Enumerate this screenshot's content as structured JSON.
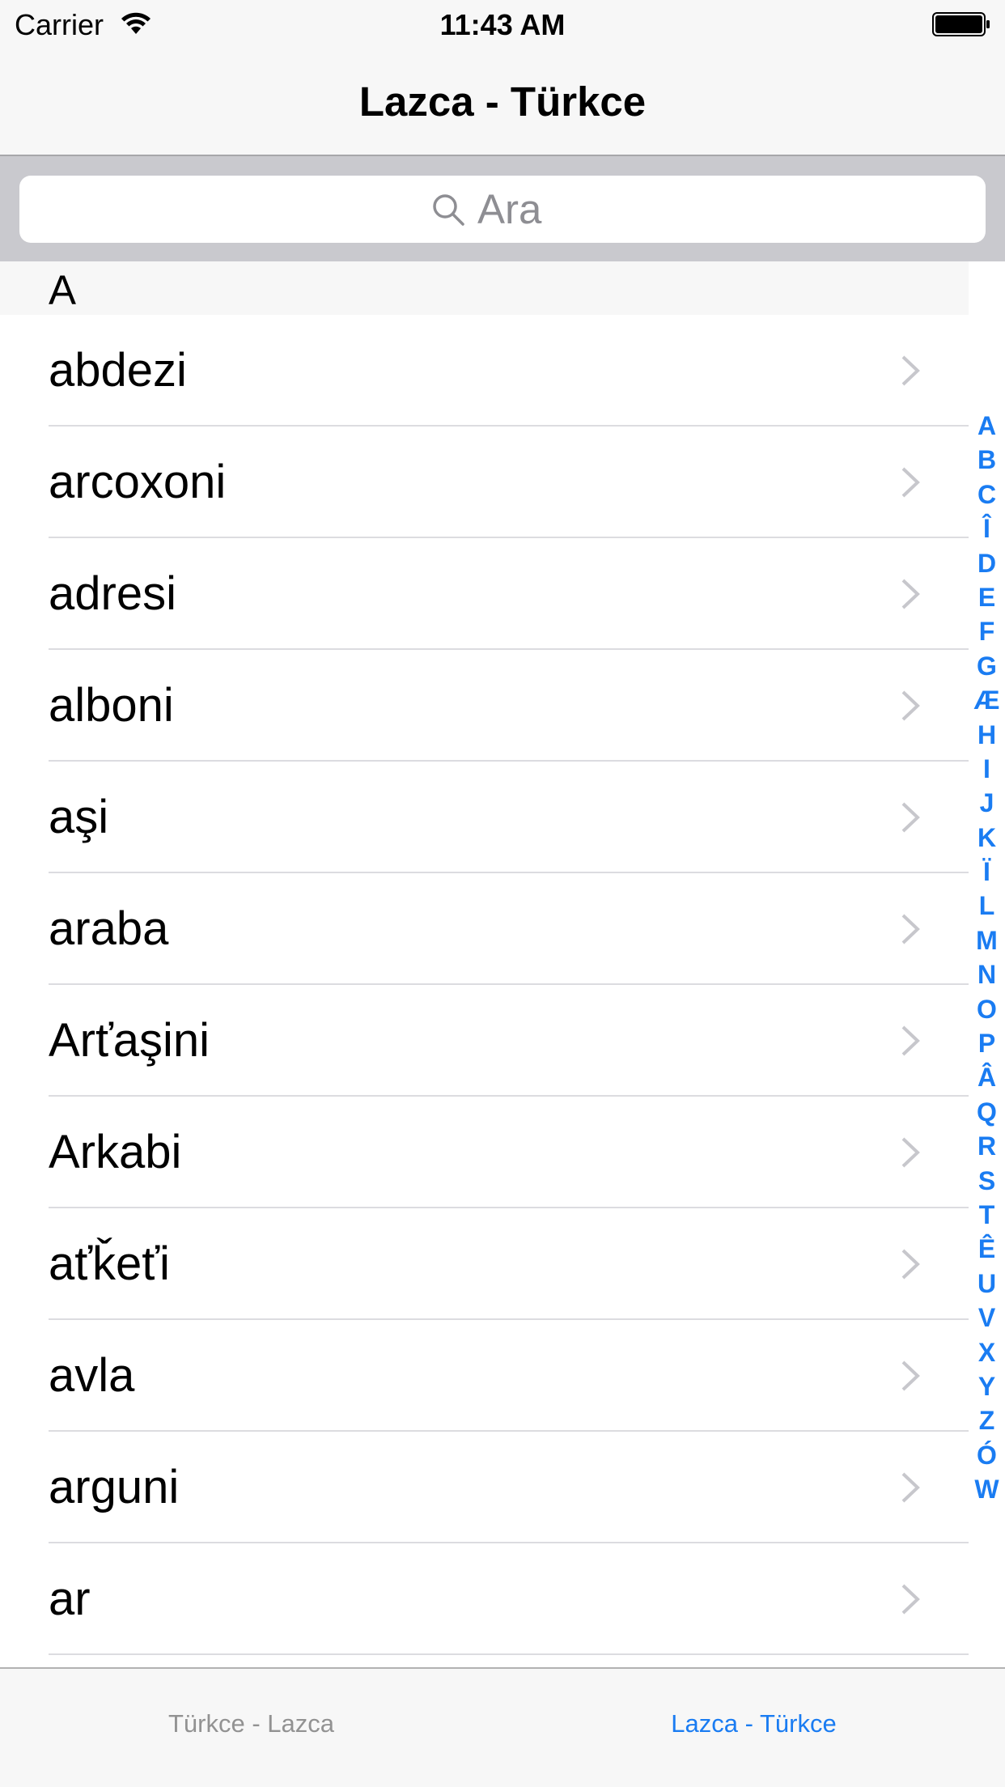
{
  "status_bar": {
    "carrier": "Carrier",
    "time": "11:43 AM",
    "wifi_icon": "wifi-icon",
    "battery_icon": "battery-icon"
  },
  "nav": {
    "title": "Lazca - Türkce"
  },
  "search": {
    "placeholder": "Ara",
    "icon": "search-icon"
  },
  "section": {
    "header": "A"
  },
  "list": {
    "rows": [
      {
        "label": "abdezi"
      },
      {
        "label": "arcoxoni"
      },
      {
        "label": "adresi"
      },
      {
        "label": "alboni"
      },
      {
        "label": "aşi"
      },
      {
        "label": "araba"
      },
      {
        "label": "Arťaşini"
      },
      {
        "label": "Arkabi"
      },
      {
        "label": "aťǩeťi"
      },
      {
        "label": "avla"
      },
      {
        "label": "arguni"
      },
      {
        "label": "ar"
      }
    ],
    "accessory_icon": "chevron-right-icon"
  },
  "index": {
    "letters": [
      "A",
      "B",
      "C",
      "Î",
      "D",
      "E",
      "F",
      "G",
      "Æ",
      "H",
      "I",
      "J",
      "K",
      "Ï",
      "L",
      "M",
      "N",
      "O",
      "P",
      "Â",
      "Q",
      "R",
      "S",
      "T",
      "Ê",
      "U",
      "V",
      "X",
      "Y",
      "Z",
      "Ó",
      "W"
    ]
  },
  "tab_bar": {
    "tabs": [
      {
        "label": "Türkce - Lazca",
        "selected": false
      },
      {
        "label": "Lazca - Türkce",
        "selected": true
      }
    ]
  },
  "colors": {
    "accent": "#1a7cf2",
    "bar_background": "#f7f7f7",
    "search_bar_background": "#c9c9ce",
    "inactive_tab": "#929292"
  }
}
